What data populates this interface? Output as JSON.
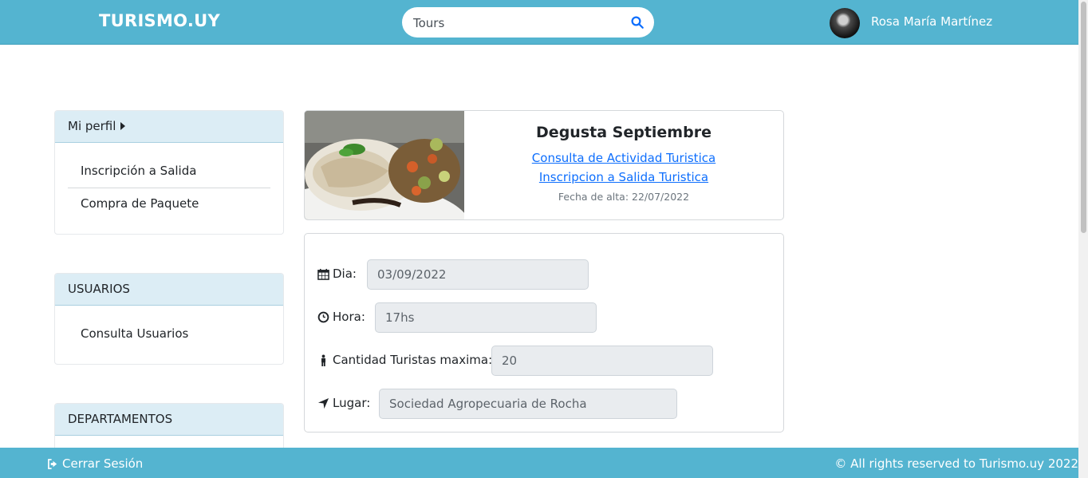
{
  "navbar": {
    "brand": "TURISMO.UY",
    "search_value": "Tours",
    "user_name": "Rosa María Martínez"
  },
  "sidebar": {
    "profile": {
      "title": "Mi perfil",
      "items": [
        "Inscripción a Salida",
        "Compra de Paquete"
      ]
    },
    "users": {
      "title": "USUARIOS",
      "items": [
        "Consulta Usuarios"
      ]
    },
    "departments": {
      "title": "DEPARTAMENTOS"
    }
  },
  "activity": {
    "title": "Degusta Septiembre",
    "link_consulta": "Consulta de Actividad Turistica",
    "link_inscripcion": "Inscripcion a Salida Turistica",
    "fecha_alta": "Fecha de alta: 22/07/2022"
  },
  "details": {
    "dia_label": "Dia:",
    "dia_value": "03/09/2022",
    "hora_label": "Hora:",
    "hora_value": "17hs",
    "cantidad_label": "Cantidad Turistas maxima:",
    "cantidad_value": "20",
    "lugar_label": "Lugar:",
    "lugar_value": "Sociedad Agropecuaria de Rocha"
  },
  "footer": {
    "logout": "Cerrar Sesión",
    "rights": "© All rights reserved to Turismo.uy 2022"
  },
  "colors": {
    "primary": "#54b4d0",
    "link": "#0d6efd",
    "card_header": "#dcedf5"
  },
  "icons": [
    "search-icon",
    "caret-right-icon",
    "calendar-icon",
    "clock-icon",
    "male-icon",
    "location-arrow-icon",
    "sign-out-icon"
  ]
}
